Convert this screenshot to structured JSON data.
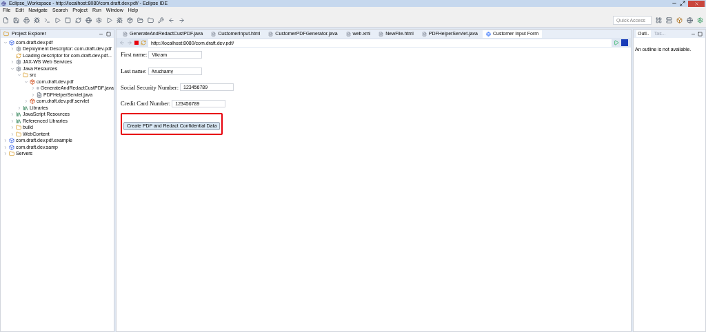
{
  "window": {
    "title": "Eclipse_Workspace - http://localhost:8080/com.draft.dev.pdf/ - Eclipse IDE"
  },
  "menu": [
    "File",
    "Edit",
    "Navigate",
    "Search",
    "Project",
    "Run",
    "Window",
    "Help"
  ],
  "quick_access": {
    "placeholder": "Quick Access"
  },
  "project_explorer": {
    "title": "Project Explorer",
    "tree": [
      {
        "label": "com.draft.dev.pdf",
        "kind": "project",
        "expanded": true,
        "children": [
          {
            "label": "Deployment Descriptor: com.draft.dev.pdf",
            "kind": "node",
            "expanded": false
          },
          {
            "label": "Loading descriptor for com.draft.dev.pdf...",
            "kind": "leaf"
          },
          {
            "label": "JAX-WS Web Services",
            "kind": "node",
            "expanded": false
          },
          {
            "label": "Java Resources",
            "kind": "node",
            "expanded": true,
            "children": [
              {
                "label": "src",
                "kind": "folder",
                "expanded": true,
                "children": [
                  {
                    "label": "com.draft.dev.pdf",
                    "kind": "package",
                    "expanded": true,
                    "children": [
                      {
                        "label": "GenerateAndRedactCustPDF.java",
                        "kind": "file",
                        "expanded": false
                      },
                      {
                        "label": "PDFHelperServlet.java",
                        "kind": "file",
                        "expanded": false
                      }
                    ]
                  },
                  {
                    "label": "com.draft.dev.pdf.servlet",
                    "kind": "package",
                    "expanded": false
                  }
                ]
              },
              {
                "label": "Libraries",
                "kind": "library",
                "expanded": false
              }
            ]
          },
          {
            "label": "JavaScript Resources",
            "kind": "library",
            "expanded": false
          },
          {
            "label": "Referenced Libraries",
            "kind": "library",
            "expanded": false
          },
          {
            "label": "build",
            "kind": "folder",
            "expanded": false
          },
          {
            "label": "WebContent",
            "kind": "folder",
            "expanded": false
          }
        ]
      },
      {
        "label": "com.draft.dev.pdf.example",
        "kind": "project",
        "expanded": false
      },
      {
        "label": "com.draft.dev.samp",
        "kind": "project",
        "expanded": false
      },
      {
        "label": "Servers",
        "kind": "folder",
        "expanded": false
      }
    ]
  },
  "editor_tabs": [
    {
      "label": "GenerateAndRedactCustPDF.java",
      "kind": "java",
      "selected": false
    },
    {
      "label": "CustomerInput.html",
      "kind": "file",
      "selected": false
    },
    {
      "label": "CustomerPDFGenerator.java",
      "kind": "java",
      "selected": false
    },
    {
      "label": "web.xml",
      "kind": "xml",
      "selected": false
    },
    {
      "label": "NewFile.html",
      "kind": "file",
      "selected": false
    },
    {
      "label": "PDFHelperServlet.java",
      "kind": "java",
      "selected": false
    },
    {
      "label": "Customer Input Form",
      "kind": "web",
      "selected": true
    }
  ],
  "browser": {
    "url": "http://localhost:8080/com.draft.dev.pdf/"
  },
  "form": {
    "fields": [
      {
        "label": "First name:",
        "value": "Vikram"
      },
      {
        "label": "Last name:",
        "value": "Aruchamy"
      },
      {
        "label": "Social Security Number:",
        "value": "123456789"
      },
      {
        "label": "Credit Card Number:",
        "value": "123456789"
      }
    ],
    "button": "Create PDF and Redact Confidential Data"
  },
  "outline": {
    "tabs": [
      {
        "label": "Outl..",
        "selected": true
      },
      {
        "label": "Tas...",
        "selected": false
      }
    ],
    "message": "An outline is not available."
  }
}
